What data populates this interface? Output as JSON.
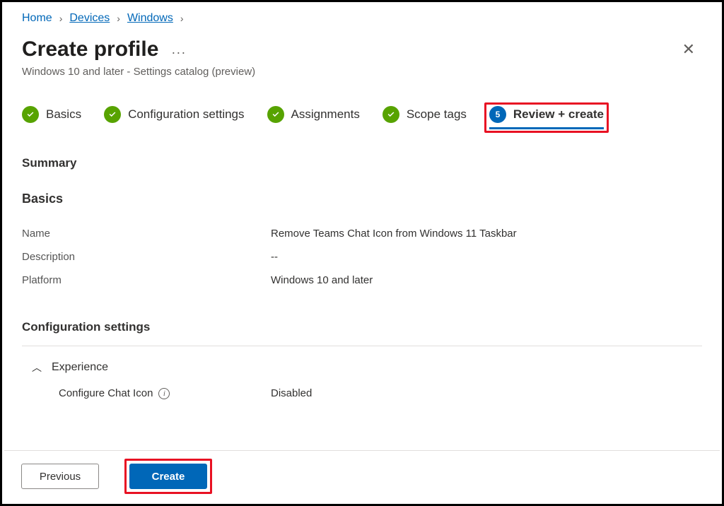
{
  "breadcrumb": {
    "items": [
      {
        "label": "Home",
        "underline": false
      },
      {
        "label": "Devices",
        "underline": true
      },
      {
        "label": "Windows",
        "underline": true
      }
    ]
  },
  "header": {
    "title": "Create profile",
    "subtitle": "Windows 10 and later - Settings catalog (preview)"
  },
  "steps": [
    {
      "label": "Basics",
      "state": "done"
    },
    {
      "label": "Configuration settings",
      "state": "done"
    },
    {
      "label": "Assignments",
      "state": "done"
    },
    {
      "label": "Scope tags",
      "state": "done"
    },
    {
      "label": "Review + create",
      "state": "current",
      "number": "5"
    }
  ],
  "summary": {
    "heading": "Summary",
    "basics_heading": "Basics",
    "fields": {
      "name_label": "Name",
      "name_value": "Remove Teams Chat Icon from Windows 11 Taskbar",
      "desc_label": "Description",
      "desc_value": "--",
      "platform_label": "Platform",
      "platform_value": "Windows 10 and later"
    },
    "config_heading": "Configuration settings",
    "group_label": "Experience",
    "setting_label": "Configure Chat Icon",
    "setting_value": "Disabled"
  },
  "footer": {
    "previous_label": "Previous",
    "create_label": "Create"
  }
}
